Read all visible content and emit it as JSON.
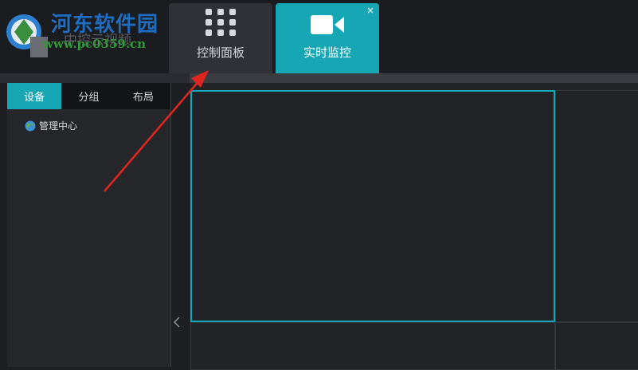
{
  "watermark": {
    "title": "河东软件园",
    "url": "www.pc0359.cn"
  },
  "app": {
    "name": "中控云视频"
  },
  "tabs": [
    {
      "label": "控制面板",
      "icon": "grid-icon",
      "active": false
    },
    {
      "label": "实时监控",
      "icon": "video-camera-icon",
      "active": true,
      "close": "×"
    }
  ],
  "sidebar": {
    "tabs": [
      {
        "label": "设备",
        "active": true
      },
      {
        "label": "分组",
        "active": false
      },
      {
        "label": "布局",
        "active": false
      }
    ],
    "tree": [
      {
        "label": "管理中心",
        "icon": "globe-icon"
      }
    ]
  },
  "colors": {
    "accent": "#16a6b4",
    "background": "#1e1f23",
    "annotation_arrow": "#e0261f"
  }
}
